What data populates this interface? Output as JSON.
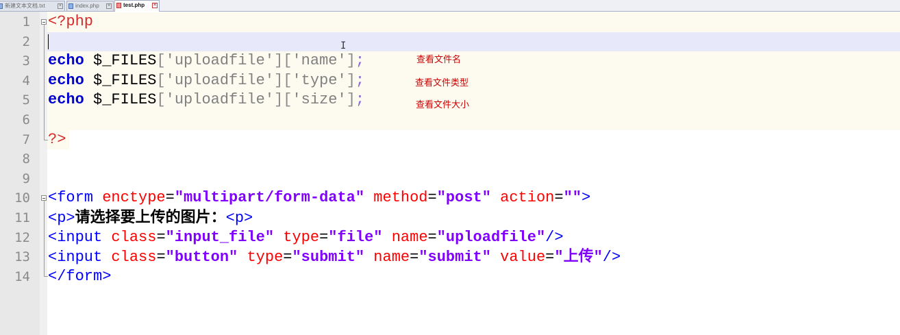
{
  "tabs": [
    {
      "label": "新建文本文档.txt",
      "active": false,
      "icon": "file-icon"
    },
    {
      "label": "index.php",
      "active": false,
      "icon": "file-icon"
    },
    {
      "label": "test.php",
      "active": true,
      "icon": "modified-file-icon"
    }
  ],
  "line_numbers": [
    "1",
    "2",
    "3",
    "4",
    "5",
    "6",
    "7",
    "8",
    "9",
    "10",
    "11",
    "12",
    "13",
    "14"
  ],
  "code": {
    "l1": {
      "open": "<?php"
    },
    "l3": {
      "kw": "echo",
      "var": " $_FILES",
      "b1": "[",
      "s1": "'uploadfile'",
      "b2": "][",
      "s2": "'name'",
      "b3": "]",
      "semi": ";"
    },
    "l4": {
      "kw": "echo",
      "var": " $_FILES",
      "b1": "[",
      "s1": "'uploadfile'",
      "b2": "][",
      "s2": "'type'",
      "b3": "]",
      "semi": ";"
    },
    "l5": {
      "kw": "echo",
      "var": " $_FILES",
      "b1": "[",
      "s1": "'uploadfile'",
      "b2": "][",
      "s2": "'size'",
      "b3": "]",
      "semi": ";"
    },
    "l7": {
      "close": "?>"
    },
    "l10": {
      "tag": "<form",
      "a1": " enctype",
      "v1": "\"multipart/form-data\"",
      "a2": " method",
      "v2": "\"post\"",
      "a3": " action",
      "v3": "\"\"",
      "end": ">"
    },
    "l11": {
      "tag": "<p>",
      "text": "请选择要上传的图片：",
      "tag2": "<p>"
    },
    "l12": {
      "tag": "<input",
      "a1": " class",
      "v1": "\"input_file\"",
      "a2": " type",
      "v2": "\"file\"",
      "a3": " name",
      "v3": "\"uploadfile\"",
      "end": "/>"
    },
    "l13": {
      "tag": "<input",
      "a1": " class",
      "v1": "\"button\"",
      "a2": " type",
      "v2": "\"submit\"",
      "a3": " name",
      "v3": "\"submit\"",
      "a4": " value",
      "v4q1": "\"",
      "v4": "上传",
      "v4q2": "\"",
      "end": "/>"
    },
    "l14": {
      "tag": "</form>"
    }
  },
  "annotations": {
    "name_note": "查看文件名",
    "type_note": "查看文件类型",
    "size_note": "查看文件大小"
  },
  "colors": {
    "keyword": "#0000cc",
    "php_delimiter": "#d42c2c",
    "html_tag": "#0000ff",
    "html_attr": "#ff0000",
    "html_attr_value": "#8000ff",
    "annotation": "#cc0000",
    "current_line": "#e8e8fb"
  }
}
